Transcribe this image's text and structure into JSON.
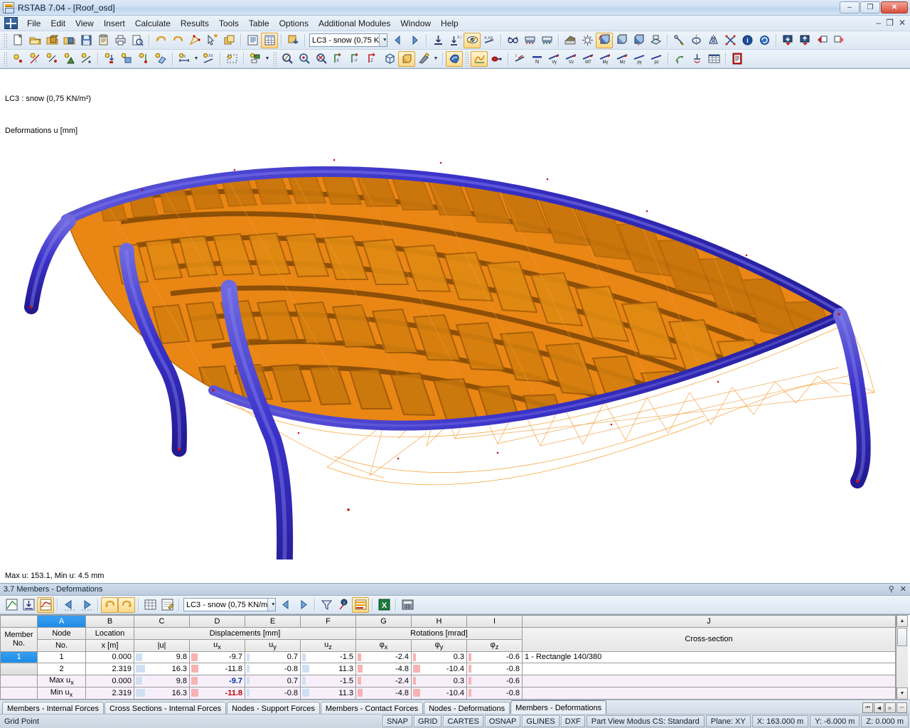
{
  "window": {
    "title": "RSTAB 7.04 - [Roof_osd]",
    "minimize": "–",
    "restore": "❐",
    "close": "✕",
    "mdi_minimize": "–",
    "mdi_restore": "❐",
    "mdi_close": "✕"
  },
  "menu": {
    "items": [
      {
        "label": "File",
        "accel": "F"
      },
      {
        "label": "Edit",
        "accel": "E"
      },
      {
        "label": "View",
        "accel": "V"
      },
      {
        "label": "Insert",
        "accel": "I"
      },
      {
        "label": "Calculate",
        "accel": "C"
      },
      {
        "label": "Results",
        "accel": "R"
      },
      {
        "label": "Tools",
        "accel": "T"
      },
      {
        "label": "Table",
        "accel": "b"
      },
      {
        "label": "Options",
        "accel": "O"
      },
      {
        "label": "Additional Modules",
        "accel": "A"
      },
      {
        "label": "Window",
        "accel": "W"
      },
      {
        "label": "Help",
        "accel": "H"
      }
    ]
  },
  "toolbar_main": {
    "load_case": "LC3 - snow (0,75 K",
    "icons": [
      "new-file-icon",
      "open-file-icon",
      "open-project-icon",
      "open-recent-icon",
      "save-icon",
      "save-all-icon",
      "print-icon",
      "print-preview-icon",
      "undo-icon",
      "redo-icon",
      "edit-model-icon",
      "select-add-icon",
      "copy-window-icon",
      "list-view-icon",
      "table-view-icon",
      "import-icon"
    ]
  },
  "toolbar_results": {
    "icons": [
      "result-down-icon",
      "result-up-icon",
      "show-values-icon",
      "show-results-icon",
      "value-label-icon",
      "glasses-icon",
      "support-force-icon",
      "support-force-2-icon",
      "render-icon",
      "light-icon",
      "rotate-3d-icon",
      "rotate-x-icon",
      "rotate-y-icon",
      "view-plane-icon",
      "pointer-icon",
      "mirror-circle-icon",
      "mirror-icon",
      "delete-node-icon",
      "info-icon",
      "refresh-icon",
      "load-down-icon",
      "load-up-icon",
      "load-left-icon",
      "load-right-icon"
    ]
  },
  "toolbar_insert": {
    "icons": [
      "node-icon",
      "line-icon",
      "member-icon",
      "support-icon",
      "nodal-support-icon",
      "load-icon",
      "member-load-icon",
      "nodal-load-icon",
      "surface-load-icon",
      "dimension-icon",
      "text-xx-icon",
      "select-rect-icon",
      "layer-icon"
    ]
  },
  "toolbar_view": {
    "icons": [
      "zoom-region-icon",
      "zoom-in-icon",
      "zoom-out-icon",
      "view-x-icon",
      "view-y-icon",
      "view-z-icon",
      "isometric-icon",
      "render-solid-icon",
      "display-props-icon",
      "3d-render-icon",
      "deformation-icon",
      "relation-icon"
    ],
    "force_labels": [
      "N",
      "Vy",
      "Vz",
      "MT",
      "My",
      "Mz",
      "py",
      "pz"
    ],
    "force_icons": [
      "axial-icon",
      "shear-y-icon",
      "shear-z-icon",
      "torsion-icon",
      "moment-y-icon",
      "moment-z-icon",
      "load-py-icon",
      "load-pz-icon",
      "deformation-result-icon",
      "support-reaction-icon",
      "result-table-icon",
      "printout-report-icon"
    ]
  },
  "viewport": {
    "label_line1": "LC3 : snow (0,75 KN/m²)",
    "label_line2": "Deformations u [mm]",
    "minmax": "Max u: 153.1, Min u: 4.5 mm",
    "colors": {
      "members_orange": "#e8820c",
      "members_dark_orange": "#9a5408",
      "arch_blue": "#3a32c8",
      "arch_blue_dark": "#201a8a",
      "deformed_outline": "#f08000",
      "background": "#ffffff"
    }
  },
  "table_panel": {
    "title": "3.7 Members - Deformations",
    "pin": "⚲",
    "close": "✕",
    "load_case": "LC3 - snow (0,75 KN/m",
    "icons": [
      "table-edit-icon",
      "table-import-icon",
      "table-results-icon",
      "prev-table-icon",
      "next-table-icon",
      "undo-table-icon",
      "redo-table-icon",
      "grid-icon",
      "edit-note-icon",
      "prev-arrow-icon",
      "next-arrow-icon",
      "filter-icon",
      "info-table-icon",
      "highlight-icon",
      "excel-export-icon",
      "calculator-icon"
    ]
  },
  "grid": {
    "column_letters": [
      "A",
      "B",
      "C",
      "D",
      "E",
      "F",
      "G",
      "H",
      "I",
      "J"
    ],
    "selected_column": "A",
    "group_headers": [
      {
        "label": "",
        "span": 1
      },
      {
        "label": "Node",
        "span": 1
      },
      {
        "label": "Location",
        "span": 1
      },
      {
        "label": "Displacements [mm]",
        "span": 4
      },
      {
        "label": "Rotations [mrad]",
        "span": 3
      },
      {
        "label": "",
        "span": 1
      }
    ],
    "sub_headers": [
      "Member\nNo.",
      "No.",
      "x [m]",
      "|u|",
      "uₓ",
      "uᵧ",
      "uᶻ",
      "φₓ",
      "φᵧ",
      "φᶻ",
      "Cross-section"
    ],
    "header_member": "Member",
    "header_member2": "No.",
    "header_node": "Node",
    "header_node2": "No.",
    "header_location": "Location",
    "header_location2": "x [m]",
    "header_u": "|u|",
    "header_ux": "u",
    "header_ux_sub": "x",
    "header_uy": "u",
    "header_uy_sub": "y",
    "header_uz": "u",
    "header_uz_sub": "z",
    "header_phix": "φ",
    "header_phix_sub": "x",
    "header_phiy": "φ",
    "header_phiy_sub": "y",
    "header_phiz": "φ",
    "header_phiz_sub": "z",
    "header_disp": "Displacements [mm]",
    "header_rot": "Rotations [mrad]",
    "header_cs": "Cross-section",
    "rows": [
      {
        "member": "1",
        "member_selected": true,
        "node": "1",
        "location": "0.000",
        "u": "9.8",
        "ux": "-9.7",
        "uy": "0.7",
        "uz": "-1.5",
        "phix": "-2.4",
        "phiy": "0.3",
        "phiz": "-0.6",
        "cross_section": "1 - Rectangle 140/380",
        "extreme": false
      },
      {
        "member": "",
        "member_selected": false,
        "node": "2",
        "location": "2.319",
        "u": "16.3",
        "ux": "-11.8",
        "uy": "-0.8",
        "uz": "11.3",
        "phix": "-4.8",
        "phiy": "-10.4",
        "phiz": "-0.8",
        "cross_section": "",
        "extreme": false
      },
      {
        "member": "",
        "member_selected": false,
        "node": "Max u",
        "node_sub": "x",
        "location": "0.000",
        "u": "9.8",
        "ux": "-9.7",
        "uy": "0.7",
        "uz": "-1.5",
        "phix": "-2.4",
        "phiy": "0.3",
        "phiz": "-0.6",
        "cross_section": "",
        "extreme": true,
        "ux_bold": "blue"
      },
      {
        "member": "",
        "member_selected": false,
        "node": "Min u",
        "node_sub": "x",
        "location": "2.319",
        "u": "16.3",
        "ux": "-11.8",
        "uy": "-0.8",
        "uz": "11.3",
        "phix": "-4.8",
        "phiy": "-10.4",
        "phiz": "-0.8",
        "cross_section": "",
        "extreme": true,
        "ux_bold": "red"
      }
    ]
  },
  "tabs": {
    "items": [
      {
        "label": "Members - Internal Forces",
        "active": false
      },
      {
        "label": "Cross Sections - Internal Forces",
        "active": false
      },
      {
        "label": "Nodes - Support Forces",
        "active": false
      },
      {
        "label": "Members - Contact Forces",
        "active": false
      },
      {
        "label": "Nodes - Deformations",
        "active": false
      },
      {
        "label": "Members - Deformations",
        "active": true
      }
    ],
    "nav": [
      "⏮",
      "◀",
      "▶",
      "⏭"
    ]
  },
  "statusbar": {
    "hint": "Grid Point",
    "toggles": [
      "SNAP",
      "GRID",
      "CARTES",
      "OSNAP",
      "GLINES",
      "DXF"
    ],
    "mode": "Part View Modus CS: Standard",
    "plane": "Plane: XY",
    "x": "X:  163.000 m",
    "y": "Y:  -6.000 m",
    "z": "Z:  0.000 m"
  }
}
